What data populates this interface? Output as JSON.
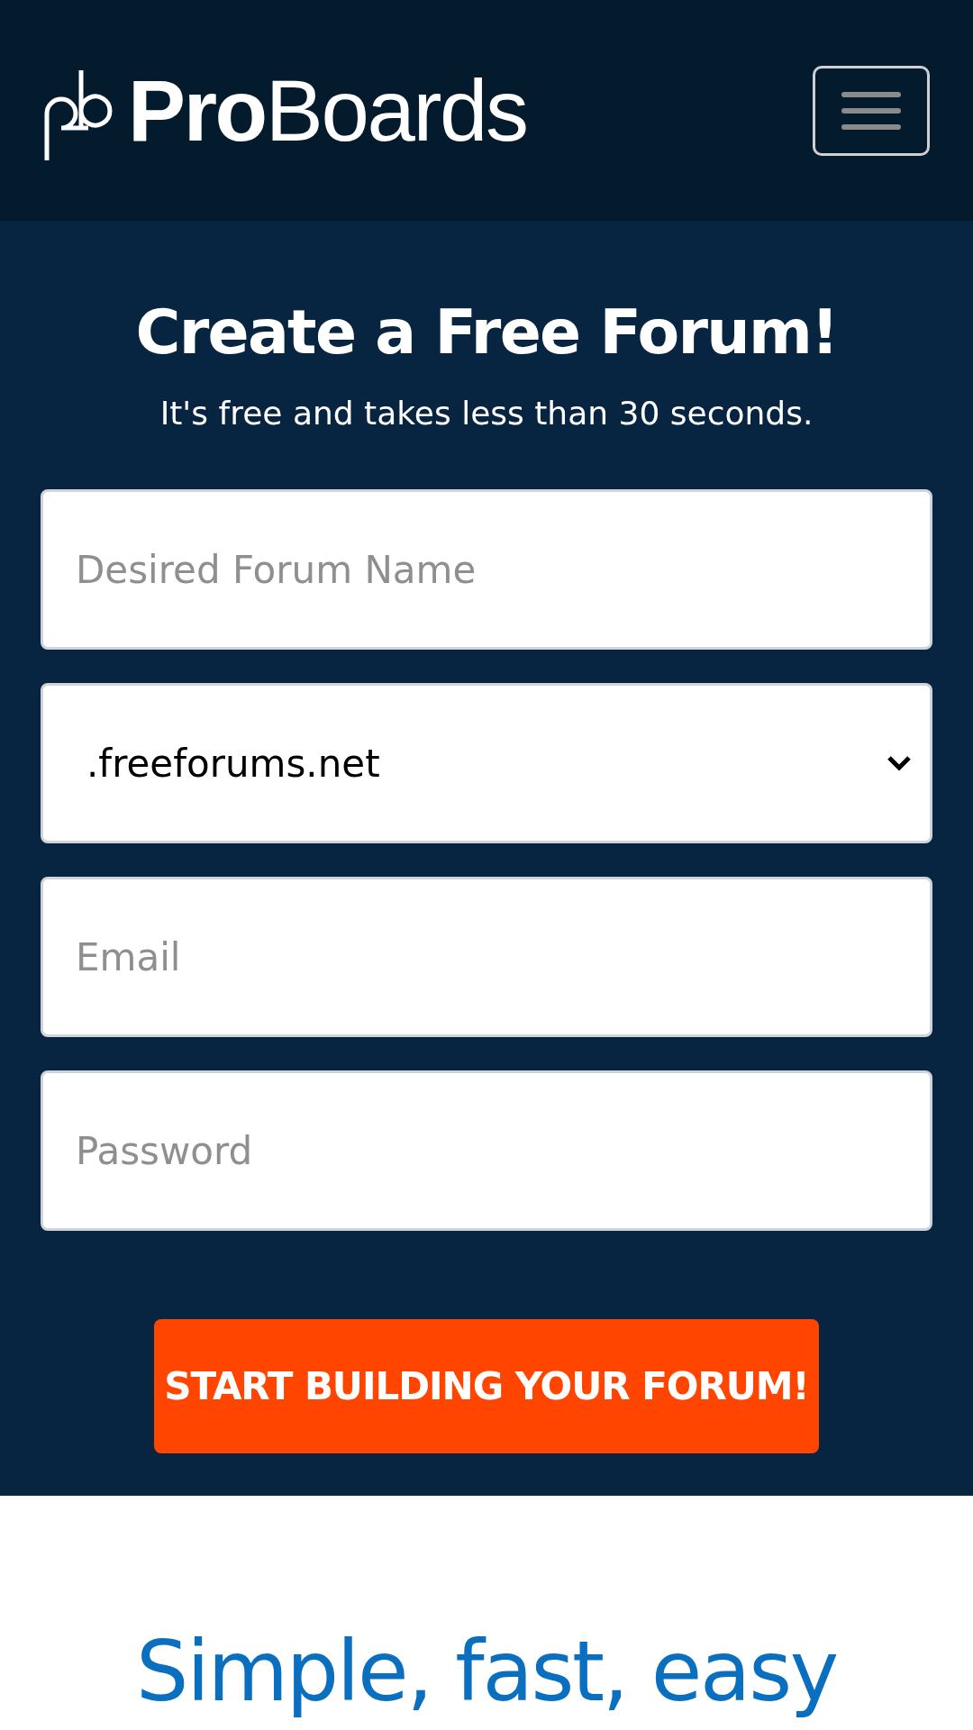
{
  "header": {
    "logo_text": "**Pro**Boards"
  },
  "hero": {
    "title": "Create a Free Forum!",
    "subtitle": "It's free and takes less than 30 seconds.",
    "fields": [
      {
        "kind": "input",
        "placeholder": "Desired Forum Name"
      },
      {
        "kind": "select",
        "value": ".freeforums.net"
      },
      {
        "kind": "input",
        "placeholder": "Email"
      },
      {
        "kind": "password",
        "placeholder": "Password"
      }
    ],
    "submit": "START BUILDING YOUR FORUM!"
  },
  "section": {
    "heading": "Simple, fast, easy"
  }
}
